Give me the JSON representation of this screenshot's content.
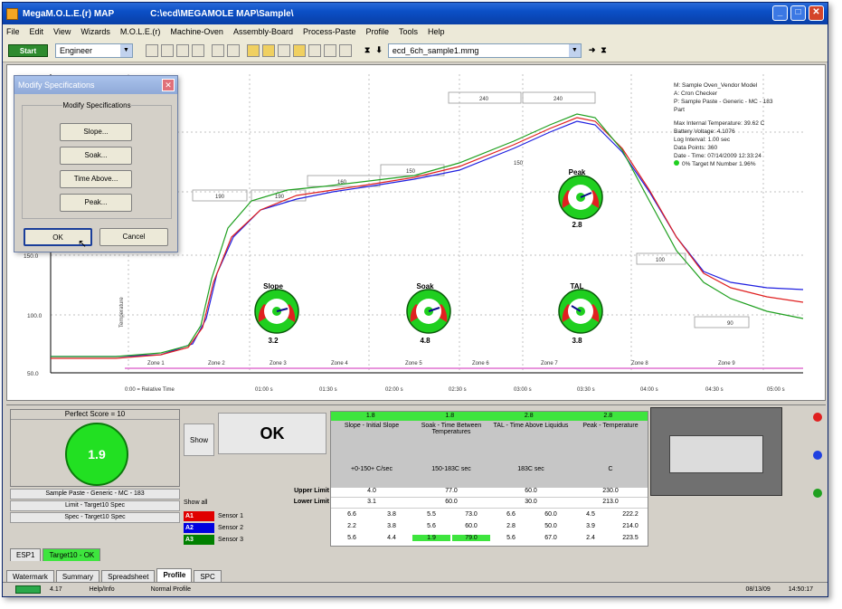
{
  "window": {
    "app_title": "MegaM.O.L.E.(r) MAP",
    "path": "C:\\ecd\\MEGAMOLE MAP\\Sample\\"
  },
  "menu": [
    "File",
    "Edit",
    "View",
    "Wizards",
    "M.O.L.E.(r)",
    "Machine-Oven",
    "Assembly-Board",
    "Process-Paste",
    "Profile",
    "Tools",
    "Help"
  ],
  "toolbar": {
    "green_button": "Start",
    "user_combo": "Engineer",
    "file_combo": "ecd_6ch_sample1.mmg"
  },
  "plot": {
    "legend_lines": [
      "M: Sample Oven_Vendor Model",
      "A: Cron Checker",
      "P: Sample Paste - Generic - MC - 183",
      "Part",
      "",
      "Max Internal Temperature: 39.62 C",
      "Battery Voltage: 4.1076",
      "Log Interval: 1.00 sec",
      "Data Points: 360",
      "Date - Time: 07/14/2009 12:33:24",
      "0% Target M Number 1.96%"
    ],
    "y_ticks": [
      "150.0",
      "100.0",
      "50.0"
    ],
    "y_axis_label": "Temperature",
    "x_ticks": [
      "0:00 = Relative Time",
      "01:00 s",
      "01:30 s",
      "02:00 s",
      "02:30 s",
      "03:00 s",
      "03:30 s",
      "04:00 s",
      "04:30 s",
      "05:00 s"
    ],
    "zones": [
      "Zone 1",
      "Zone 2",
      "Zone 3",
      "Zone 4",
      "Zone 5",
      "Zone 6",
      "Zone 7",
      "Zone 8",
      "Zone 9"
    ],
    "boxes": [
      "240",
      "240",
      "190",
      "190",
      "160",
      "150",
      "150",
      "100",
      "90"
    ],
    "gauges": [
      {
        "name": "Slope",
        "value": "3.2"
      },
      {
        "name": "Soak",
        "value": "4.8"
      },
      {
        "name": "Peak",
        "value": "2.8"
      },
      {
        "name": "TAL",
        "value": "3.8"
      }
    ]
  },
  "dialog": {
    "title": "Modify Specifications",
    "group": "Modify Specifications",
    "buttons": [
      "Slope...",
      "Soak...",
      "Time Above...",
      "Peak..."
    ],
    "ok": "OK",
    "cancel": "Cancel"
  },
  "bottom": {
    "perfect_score": "Perfect Score = 10",
    "score": "1.9",
    "side_rows": [
      "Sample Paste - Generic - MC - 183",
      "Limit - Target10 Spec",
      "Spec - Target10 Spec"
    ],
    "show_label": "Show",
    "show_all": "Show all",
    "ok_text": "OK",
    "green_header": [
      "1.8",
      "1.8",
      "2.8",
      "2.8"
    ],
    "col_heads": [
      "Slope - Initial Slope",
      "Soak - Time Between Temperatures",
      "TAL - Time Above Liquidus",
      "Peak - Temperature"
    ],
    "col_units": [
      "+0-150+\nC/sec",
      "150-183C\nsec",
      "183C\nsec",
      "C"
    ],
    "upper_label": "Upper Limit",
    "lower_label": "Lower Limit",
    "upper": [
      "4.0",
      "77.0",
      "60.0",
      "230.0"
    ],
    "lower": [
      "3.1",
      "60.0",
      "30.0",
      "213.0"
    ],
    "sensors": [
      {
        "tag": "A1",
        "label": "Sensor 1",
        "color": "#e00000",
        "vals": [
          "6.6",
          "3.8",
          "5.5",
          "73.0",
          "6.6",
          "60.0",
          "4.5",
          "222.2"
        ]
      },
      {
        "tag": "A2",
        "label": "Sensor 2",
        "color": "#0000e0",
        "vals": [
          "2.2",
          "3.8",
          "5.6",
          "60.0",
          "2.8",
          "50.0",
          "3.9",
          "214.0"
        ]
      },
      {
        "tag": "A3",
        "label": "Sensor 3",
        "color": "#008000",
        "vals": [
          "5.6",
          "4.4",
          "1.9",
          "79.0",
          "5.6",
          "67.0",
          "2.4",
          "223.5"
        ]
      }
    ]
  },
  "sheet_tabs": [
    "ESP1",
    "Target10 - OK"
  ],
  "main_tabs": [
    "Watermark",
    "Summary",
    "Spreadsheet",
    "Profile",
    "SPC"
  ],
  "status": {
    "left": "4.17",
    "mid1": "Help/Info",
    "mid2": "Normal Profile",
    "date": "08/13/09",
    "time": "14:50:17"
  },
  "colors": {
    "red": "#e02020",
    "blue": "#2020e0",
    "green": "#20a020",
    "accent_green": "#22e022"
  }
}
